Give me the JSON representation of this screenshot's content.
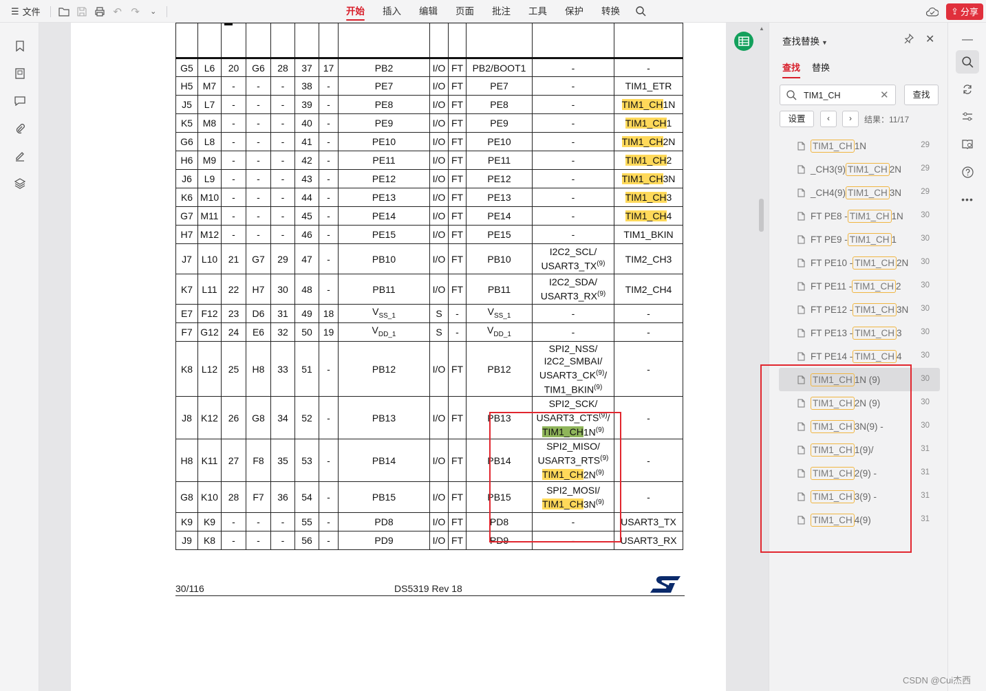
{
  "topbar": {
    "file_label": "文件",
    "menu": [
      "开始",
      "插入",
      "编辑",
      "页面",
      "批注",
      "工具",
      "保护",
      "转换"
    ],
    "active_menu": "开始",
    "share_label": "分享"
  },
  "table_rows": [
    {
      "c": [
        "G5",
        "L6",
        "20",
        "G6",
        "28",
        "37",
        "17",
        "PB2",
        "I/O",
        "FT",
        "PB2/BOOT1",
        "-",
        "-"
      ]
    },
    {
      "c": [
        "H5",
        "M7",
        "-",
        "-",
        "-",
        "38",
        "-",
        "PE7",
        "I/O",
        "FT",
        "PE7",
        "-",
        "TIM1_ETR"
      ]
    },
    {
      "c": [
        "J5",
        "L7",
        "-",
        "-",
        "-",
        "39",
        "-",
        "PE8",
        "I/O",
        "FT",
        "PE8",
        "-",
        ""
      ],
      "last": {
        "hl": "TIM1_CH",
        "rest": "1N"
      }
    },
    {
      "c": [
        "K5",
        "M8",
        "-",
        "-",
        "-",
        "40",
        "-",
        "PE9",
        "I/O",
        "FT",
        "PE9",
        "-",
        ""
      ],
      "last": {
        "hl": "TIM1_CH",
        "rest": "1"
      }
    },
    {
      "c": [
        "G6",
        "L8",
        "-",
        "-",
        "-",
        "41",
        "-",
        "PE10",
        "I/O",
        "FT",
        "PE10",
        "-",
        ""
      ],
      "last": {
        "hl": "TIM1_CH",
        "rest": "2N"
      }
    },
    {
      "c": [
        "H6",
        "M9",
        "-",
        "-",
        "-",
        "42",
        "-",
        "PE11",
        "I/O",
        "FT",
        "PE11",
        "-",
        ""
      ],
      "last": {
        "hl": "TIM1_CH",
        "rest": "2"
      }
    },
    {
      "c": [
        "J6",
        "L9",
        "-",
        "-",
        "-",
        "43",
        "-",
        "PE12",
        "I/O",
        "FT",
        "PE12",
        "-",
        ""
      ],
      "last": {
        "hl": "TIM1_CH",
        "rest": "3N"
      }
    },
    {
      "c": [
        "K6",
        "M10",
        "-",
        "-",
        "-",
        "44",
        "-",
        "PE13",
        "I/O",
        "FT",
        "PE13",
        "-",
        ""
      ],
      "last": {
        "hl": "TIM1_CH",
        "rest": "3"
      }
    },
    {
      "c": [
        "G7",
        "M11",
        "-",
        "-",
        "-",
        "45",
        "-",
        "PE14",
        "I/O",
        "FT",
        "PE14",
        "-",
        ""
      ],
      "last": {
        "hl": "TIM1_CH",
        "rest": "4"
      }
    },
    {
      "c": [
        "H7",
        "M12",
        "-",
        "-",
        "-",
        "46",
        "-",
        "PE15",
        "I/O",
        "FT",
        "PE15",
        "-",
        "TIM1_BKIN"
      ]
    },
    {
      "c": [
        "J7",
        "L10",
        "21",
        "G7",
        "29",
        "47",
        "-",
        "PB10",
        "I/O",
        "FT",
        "PB10",
        "",
        "TIM2_CH3"
      ],
      "alt": [
        [
          "I2C2_SCL/",
          ""
        ],
        [
          "USART3_TX",
          "(9)"
        ]
      ]
    },
    {
      "c": [
        "K7",
        "L11",
        "22",
        "H7",
        "30",
        "48",
        "-",
        "PB11",
        "I/O",
        "FT",
        "PB11",
        "",
        "TIM2_CH4"
      ],
      "alt": [
        [
          "I2C2_SDA/",
          ""
        ],
        [
          "USART3_RX",
          "(9)"
        ]
      ]
    },
    {
      "c": [
        "E7",
        "F12",
        "23",
        "D6",
        "31",
        "49",
        "18",
        "",
        "S",
        "-",
        "",
        "-",
        "-"
      ],
      "vss": true
    },
    {
      "c": [
        "F7",
        "G12",
        "24",
        "E6",
        "32",
        "50",
        "19",
        "",
        "S",
        "-",
        "",
        "-",
        "-"
      ],
      "vdd": true
    },
    {
      "c": [
        "K8",
        "L12",
        "25",
        "H8",
        "33",
        "51",
        "-",
        "PB12",
        "I/O",
        "FT",
        "PB12",
        "",
        "-"
      ],
      "alt": [
        [
          "SPI2_NSS/",
          ""
        ],
        [
          "I2C2_SMBAI/",
          ""
        ],
        [
          "USART3_CK",
          "(9)",
          "/"
        ],
        [
          "TIM1_BKIN",
          "(9)"
        ]
      ]
    },
    {
      "c": [
        "J8",
        "K12",
        "26",
        "G8",
        "34",
        "52",
        "-",
        "PB13",
        "I/O",
        "FT",
        "PB13",
        "",
        "-"
      ],
      "alt": [
        [
          "SPI2_SCK/",
          ""
        ],
        [
          "USART3_CTS",
          "(9)",
          "/"
        ]
      ],
      "alt_hl": {
        "hl": "TIM1_CH",
        "rest": "1N",
        "sup": "(9)",
        "cur": true
      }
    },
    {
      "c": [
        "H8",
        "K11",
        "27",
        "F8",
        "35",
        "53",
        "-",
        "PB14",
        "I/O",
        "FT",
        "PB14",
        "",
        "-"
      ],
      "alt": [
        [
          "SPI2_MISO/",
          ""
        ],
        [
          "USART3_RTS",
          "(9)"
        ]
      ],
      "alt_hl": {
        "hl": "TIM1_CH",
        "rest": "2N",
        "sup": "(9)"
      }
    },
    {
      "c": [
        "G8",
        "K10",
        "28",
        "F7",
        "36",
        "54",
        "-",
        "PB15",
        "I/O",
        "FT",
        "PB15",
        "",
        "-"
      ],
      "alt": [
        [
          "SPI2_MOSI/",
          ""
        ]
      ],
      "alt_hl": {
        "hl": "TIM1_CH",
        "rest": "3N",
        "sup": "(9)"
      }
    },
    {
      "c": [
        "K9",
        "K9",
        "-",
        "-",
        "-",
        "55",
        "-",
        "PD8",
        "I/O",
        "FT",
        "PD8",
        "-",
        "USART3_TX"
      ]
    },
    {
      "c": [
        "J9",
        "K8",
        "-",
        "-",
        "-",
        "56",
        "-",
        "PD9",
        "I/O",
        "FT",
        "PD9",
        "-",
        "USART3_RX"
      ]
    }
  ],
  "vss": {
    "main": "V",
    "sub": "SS_1"
  },
  "vdd": {
    "main": "V",
    "sub": "DD_1"
  },
  "footer": {
    "page": "30/116",
    "doc": "DS5319 Rev 18"
  },
  "panel": {
    "title": "查找替换",
    "tabs": [
      "查找",
      "替换"
    ],
    "search_value": "TIM1_CH",
    "find_label": "查找",
    "settings_label": "设置",
    "result_count": "结果：11/17",
    "results": [
      {
        "pre": "",
        "match": "TIM1_CH",
        "post": "1N",
        "page": "29"
      },
      {
        "pre": "_CH3(9) ",
        "match": "TIM1_CH",
        "post": "2N",
        "page": "29"
      },
      {
        "pre": "_CH4(9) ",
        "match": "TIM1_CH",
        "post": "3N",
        "page": "29"
      },
      {
        "pre": "FT PE8 - ",
        "match": "TIM1_CH",
        "post": "1N",
        "page": "30"
      },
      {
        "pre": "FT PE9 - ",
        "match": "TIM1_CH",
        "post": "1",
        "page": "30"
      },
      {
        "pre": "FT PE10 - ",
        "match": "TIM1_CH",
        "post": "2N",
        "page": "30"
      },
      {
        "pre": "FT PE11 - ",
        "match": "TIM1_CH",
        "post": "2",
        "page": "30"
      },
      {
        "pre": "FT PE12 - ",
        "match": "TIM1_CH",
        "post": "3N",
        "page": "30"
      },
      {
        "pre": "FT PE13 - ",
        "match": "TIM1_CH",
        "post": "3",
        "page": "30"
      },
      {
        "pre": "FT PE14 - ",
        "match": "TIM1_CH",
        "post": "4",
        "page": "30"
      },
      {
        "pre": "",
        "match": "TIM1_CH",
        "post": "1N (9)",
        "page": "30",
        "selected": true
      },
      {
        "pre": "",
        "match": "TIM1_CH",
        "post": "2N (9)",
        "page": "30"
      },
      {
        "pre": "",
        "match": "TIM1_CH",
        "post": "3N(9) -",
        "page": "30"
      },
      {
        "pre": "",
        "match": "TIM1_CH",
        "post": "1(9)/",
        "page": "31"
      },
      {
        "pre": "",
        "match": "TIM1_CH",
        "post": "2(9) -",
        "page": "31"
      },
      {
        "pre": "",
        "match": "TIM1_CH",
        "post": "3(9) -",
        "page": "31"
      },
      {
        "pre": "",
        "match": "TIM1_CH",
        "post": "4(9)",
        "page": "31"
      }
    ]
  },
  "watermark": "CSDN @Cui杰西"
}
